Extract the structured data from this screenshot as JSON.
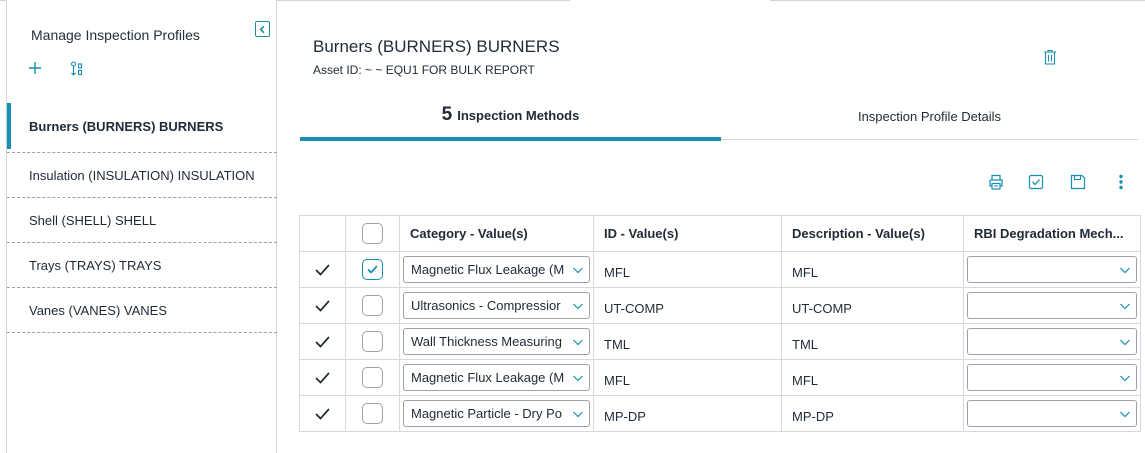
{
  "sidebar": {
    "title": "Manage Inspection Profiles",
    "items": [
      {
        "label": "Burners (BURNERS) BURNERS",
        "active": true
      },
      {
        "label": "Insulation (INSULATION) INSULATION"
      },
      {
        "label": "Shell (SHELL) SHELL"
      },
      {
        "label": "Trays (TRAYS) TRAYS"
      },
      {
        "label": "Vanes (VANES) VANES"
      }
    ]
  },
  "header": {
    "title": "Burners (BURNERS) BURNERS",
    "asset_id": "Asset ID: ~ ~ EQU1 FOR BULK REPORT"
  },
  "tabs": [
    {
      "count": "5",
      "label": "Inspection Methods",
      "active": true
    },
    {
      "label": "Inspection Profile Details"
    }
  ],
  "toolbar": {
    "icons": [
      "print-icon",
      "check-all-icon",
      "save-icon",
      "more-icon"
    ]
  },
  "table": {
    "columns": [
      "Category - Value(s)",
      "ID - Value(s)",
      "Description - Value(s)",
      "RBI Degradation Mech..."
    ],
    "rows": [
      {
        "category": "Magnetic Flux Leakage (M",
        "id": "MFL",
        "description": "MFL",
        "rbi": "",
        "checked": true
      },
      {
        "category": "Ultrasonics - Compressior",
        "id": "UT-COMP",
        "description": "UT-COMP",
        "rbi": "",
        "checked": false
      },
      {
        "category": "Wall Thickness Measuring",
        "id": "TML",
        "description": "TML",
        "rbi": "",
        "checked": false
      },
      {
        "category": "Magnetic Flux Leakage (M",
        "id": "MFL",
        "description": "MFL",
        "rbi": "",
        "checked": false
      },
      {
        "category": "Magnetic Particle - Dry Po",
        "id": "MP-DP",
        "description": "MP-DP",
        "rbi": "",
        "checked": false
      }
    ]
  },
  "colors": {
    "accent": "#178fb0",
    "text": "#1f2a36",
    "border": "#cfd4d8"
  }
}
